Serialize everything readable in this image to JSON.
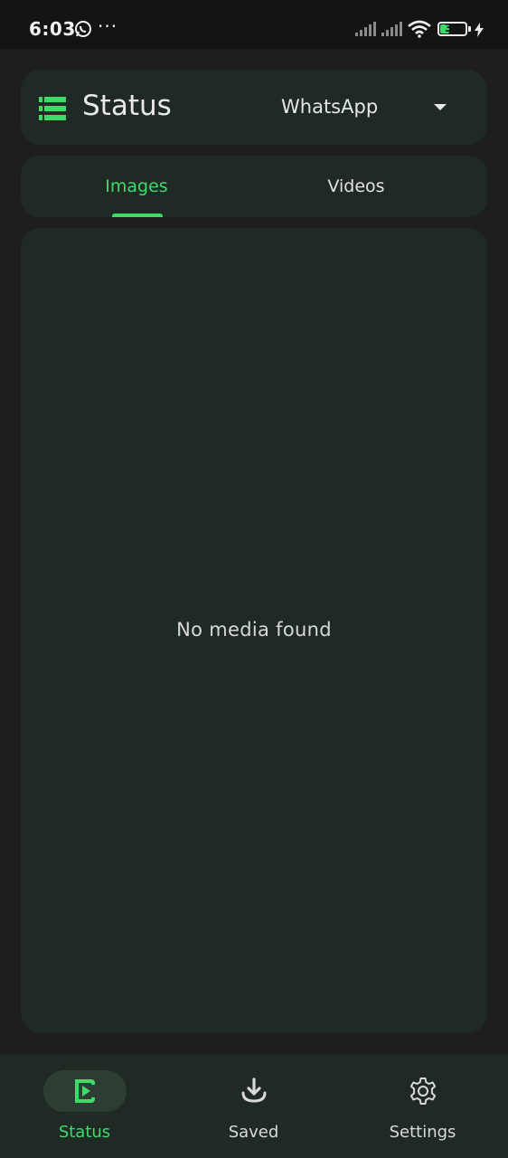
{
  "status_bar": {
    "time": "6:03",
    "dots": "···",
    "battery_level": "34",
    "battery_fraction": 0.34,
    "icons": [
      "whatsapp-icon",
      "signal-icon",
      "signal-icon",
      "wifi-icon",
      "battery-icon",
      "charging-icon"
    ]
  },
  "header": {
    "title": "Status",
    "app_selector": {
      "selected": "WhatsApp"
    },
    "menu_icon": "menu-icon"
  },
  "tabs": [
    {
      "label": "Images",
      "active": true
    },
    {
      "label": "Videos",
      "active": false
    }
  ],
  "content": {
    "empty_message": "No media found"
  },
  "bottom_nav": {
    "items": [
      {
        "label": "Status",
        "icon": "status-play-icon",
        "active": true
      },
      {
        "label": "Saved",
        "icon": "download-icon",
        "active": false
      },
      {
        "label": "Settings",
        "icon": "gear-icon",
        "active": false
      }
    ]
  },
  "colors": {
    "accent": "#3ddc6a",
    "card": "#1f2a24",
    "background": "#1e1e1e"
  }
}
